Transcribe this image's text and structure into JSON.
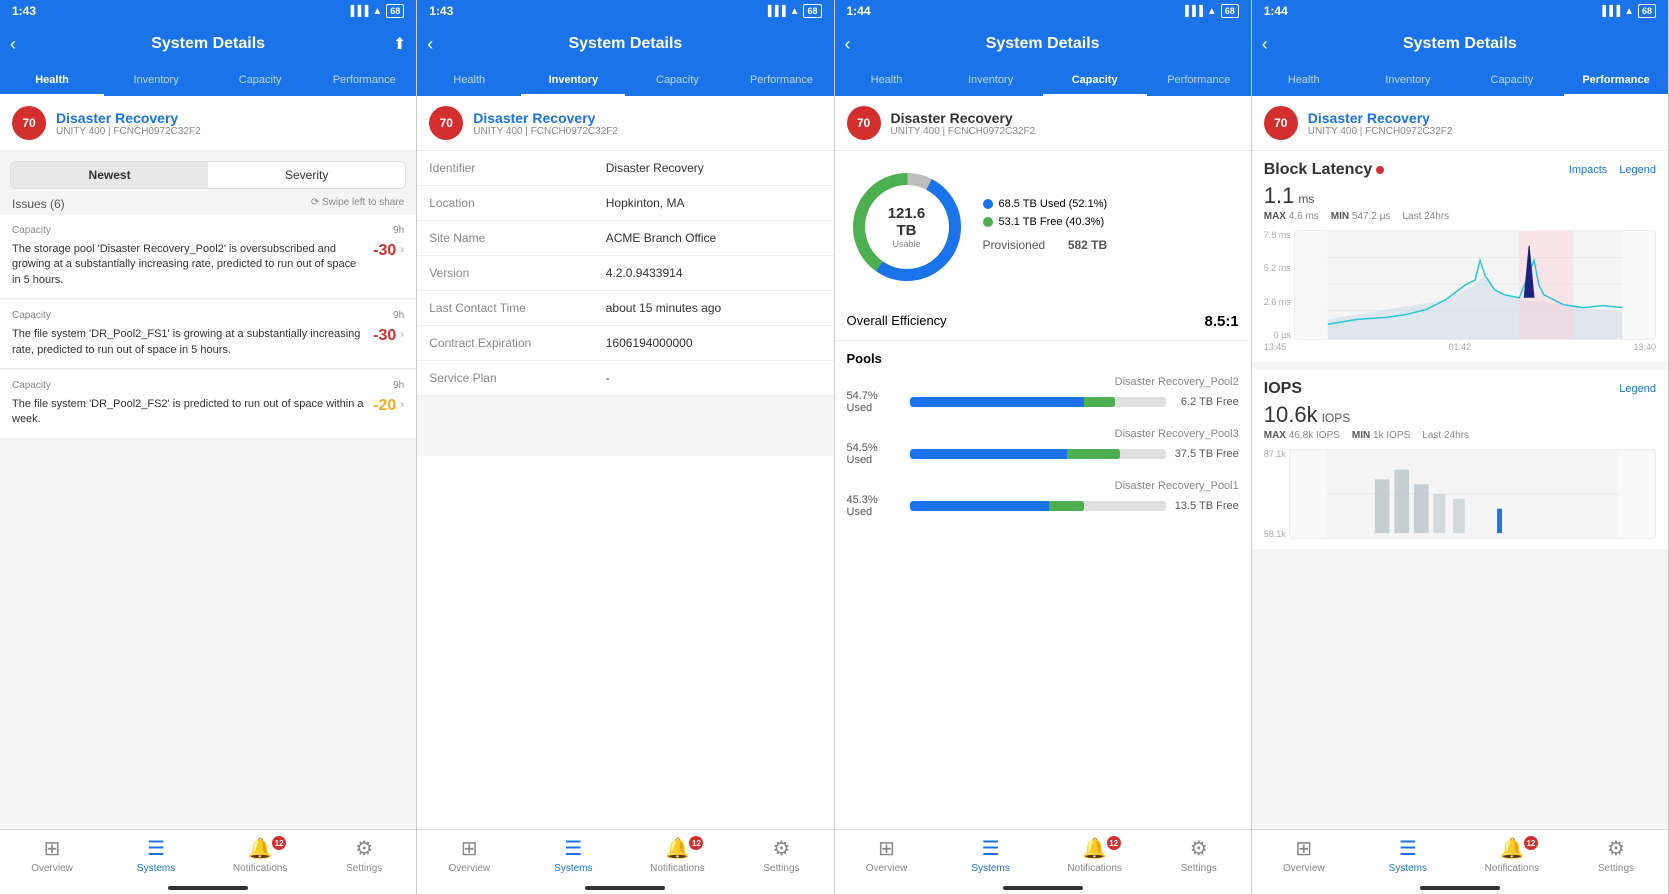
{
  "panels": [
    {
      "id": "panel1",
      "tab": "health",
      "time": "1:43",
      "title": "System Details",
      "tabs": [
        "Health",
        "Inventory",
        "Capacity",
        "Performance"
      ],
      "activeTab": 0,
      "score": 70,
      "systemName": "Disaster Recovery",
      "systemSub": "UNITY 400 | FCNCH0972C32F2",
      "sortOptions": [
        "Newest",
        "Severity"
      ],
      "activeSortIdx": 0,
      "issuesLabel": "Issues (6)",
      "swipeHint": "⟳ Swipe left to share",
      "issues": [
        {
          "category": "Capacity",
          "time": "9h",
          "text": "The storage pool 'Disaster Recovery_Pool2' is oversubscribed and growing at a substantially increasing rate, predicted to run out of space in 5 hours.",
          "score": "-30",
          "scoreType": "neg"
        },
        {
          "category": "Capacity",
          "time": "9h",
          "text": "The file system 'DR_Pool2_FS1' is growing at a substantially increasing rate, predicted to run out of space in 5 hours.",
          "score": "-30",
          "scoreType": "neg"
        },
        {
          "category": "Capacity",
          "time": "9h",
          "text": "The file system 'DR_Pool2_FS2' is predicted to run out of space within a week.",
          "score": "-20",
          "scoreType": "warn"
        }
      ],
      "bottomNav": [
        "Overview",
        "Systems",
        "Notifications",
        "Settings"
      ],
      "activeNav": 1,
      "notificationBadge": 12
    },
    {
      "id": "panel2",
      "tab": "inventory",
      "time": "1:43",
      "title": "System Details",
      "tabs": [
        "Health",
        "Inventory",
        "Capacity",
        "Performance"
      ],
      "activeTab": 1,
      "score": 70,
      "systemName": "Disaster Recovery",
      "systemSub": "UNITY 400 | FCNCH0972C32F2",
      "fields": [
        {
          "label": "Identifier",
          "value": "Disaster Recovery"
        },
        {
          "label": "Location",
          "value": "Hopkinton, MA"
        },
        {
          "label": "Site Name",
          "value": "ACME Branch Office"
        },
        {
          "label": "Version",
          "value": "4.2.0.9433914"
        },
        {
          "label": "Last Contact Time",
          "value": "about 15 minutes ago"
        },
        {
          "label": "Contract Expiration",
          "value": "1606194000000"
        },
        {
          "label": "Service Plan",
          "value": "-"
        }
      ],
      "bottomNav": [
        "Overview",
        "Systems",
        "Notifications",
        "Settings"
      ],
      "activeNav": 1,
      "notificationBadge": 12
    },
    {
      "id": "panel3",
      "tab": "capacity",
      "time": "1:44",
      "title": "System Details",
      "tabs": [
        "Health",
        "Inventory",
        "Capacity",
        "Performance"
      ],
      "activeTab": 2,
      "score": 70,
      "systemName": "Disaster Recovery",
      "systemSub": "UNITY 400 | FCNCH0972C32F2",
      "donut": {
        "total": "121.6 TB",
        "label": "Usable",
        "used": 52.1,
        "free": 40.3,
        "gray": 7.6,
        "usedTB": "68.5 TB",
        "usedPct": "52.1%",
        "freeTB": "53.1 TB",
        "freePct": "40.3%",
        "provisioned": "582 TB"
      },
      "efficiency": "8.5:1",
      "pools": [
        {
          "name": "Disaster Recovery_Pool2",
          "usedPct": 54.7,
          "freeTB": "6.2 TB Free",
          "label": "54.7% Used"
        },
        {
          "name": "Disaster Recovery_Pool3",
          "usedPct": 54.5,
          "freeTB": "37.5 TB Free",
          "label": "54.5% Used"
        },
        {
          "name": "Disaster Recovery_Pool1",
          "usedPct": 45.3,
          "freeTB": "13.5 TB Free",
          "label": "45.3% Used"
        }
      ],
      "bottomNav": [
        "Overview",
        "Systems",
        "Notifications",
        "Settings"
      ],
      "activeNav": 1,
      "notificationBadge": 12
    },
    {
      "id": "panel4",
      "tab": "performance",
      "time": "1:44",
      "title": "System Details",
      "tabs": [
        "Health",
        "Inventory",
        "Capacity",
        "Performance"
      ],
      "activeTab": 3,
      "score": 70,
      "systemName": "Disaster Recovery",
      "systemSub": "UNITY 400 | FCNCH0972C32F2",
      "blockLatency": {
        "title": "Block Latency",
        "value": "1.1",
        "unit": "ms",
        "max": "4.6 ms",
        "min": "547.2 μs",
        "period": "Last 24hrs",
        "yLabels": [
          "7.8 ms",
          "5.2 ms",
          "2.6 ms",
          "0 μs"
        ],
        "xLabels": [
          "13:45",
          "01:42",
          "13:40"
        ]
      },
      "iops": {
        "title": "IOPS",
        "value": "10.6k",
        "unit": "IOPS",
        "max": "46.8k IOPS",
        "min": "1k IOPS",
        "period": "Last 24hrs",
        "yLabels": [
          "87.1k",
          "58.1k"
        ]
      },
      "bottomNav": [
        "Overview",
        "Systems",
        "Notifications",
        "Settings"
      ],
      "activeNav": 1,
      "notificationBadge": 12
    }
  ]
}
